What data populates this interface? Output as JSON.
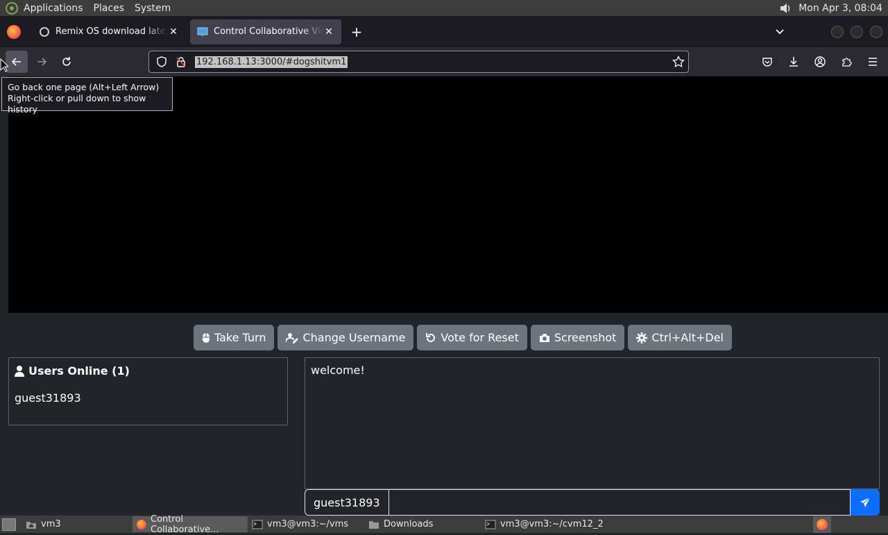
{
  "top_panel": {
    "menus": [
      "Applications",
      "Places",
      "System"
    ],
    "clock": "Mon Apr  3, 08:04"
  },
  "tabs": [
    {
      "title": "Remix OS download latest v",
      "active": false
    },
    {
      "title": "Control Collaborative Virtual",
      "active": true
    }
  ],
  "navbar": {
    "url": "192.168.1.13:3000/#dogshitvm1"
  },
  "tooltip": {
    "line1": "Go back one page (Alt+Left Arrow)",
    "line2": "Right-click or pull down to show history"
  },
  "vm_buttons": {
    "take_turn": "Take Turn",
    "change_username": "Change Username",
    "vote_reset": "Vote for Reset",
    "screenshot": "Screenshot",
    "ctrl_alt_del": "Ctrl+Alt+Del"
  },
  "users": {
    "title": "Users Online (1)",
    "list": [
      "guest31893"
    ]
  },
  "chat": {
    "messages": [
      "welcome!"
    ],
    "username": "guest31893",
    "input_value": ""
  },
  "taskbar": {
    "items": [
      {
        "label": "vm3",
        "icon": "home-folder-icon",
        "active": false
      },
      {
        "label": "Control Collaborative...",
        "icon": "firefox-icon",
        "active": true
      },
      {
        "label": "vm3@vm3:~/vms",
        "icon": "terminal-icon",
        "active": false
      },
      {
        "label": "Downloads",
        "icon": "folder-icon",
        "active": false
      },
      {
        "label": "vm3@vm3:~/cvm12_2",
        "icon": "terminal-icon",
        "active": false
      }
    ]
  },
  "colors": {
    "page_bg": "#212529",
    "button_bg": "#6c757d",
    "send_button": "#0d6efd",
    "browser_toolbar": "#2b2a33",
    "tabstrip": "#1c1b22"
  }
}
